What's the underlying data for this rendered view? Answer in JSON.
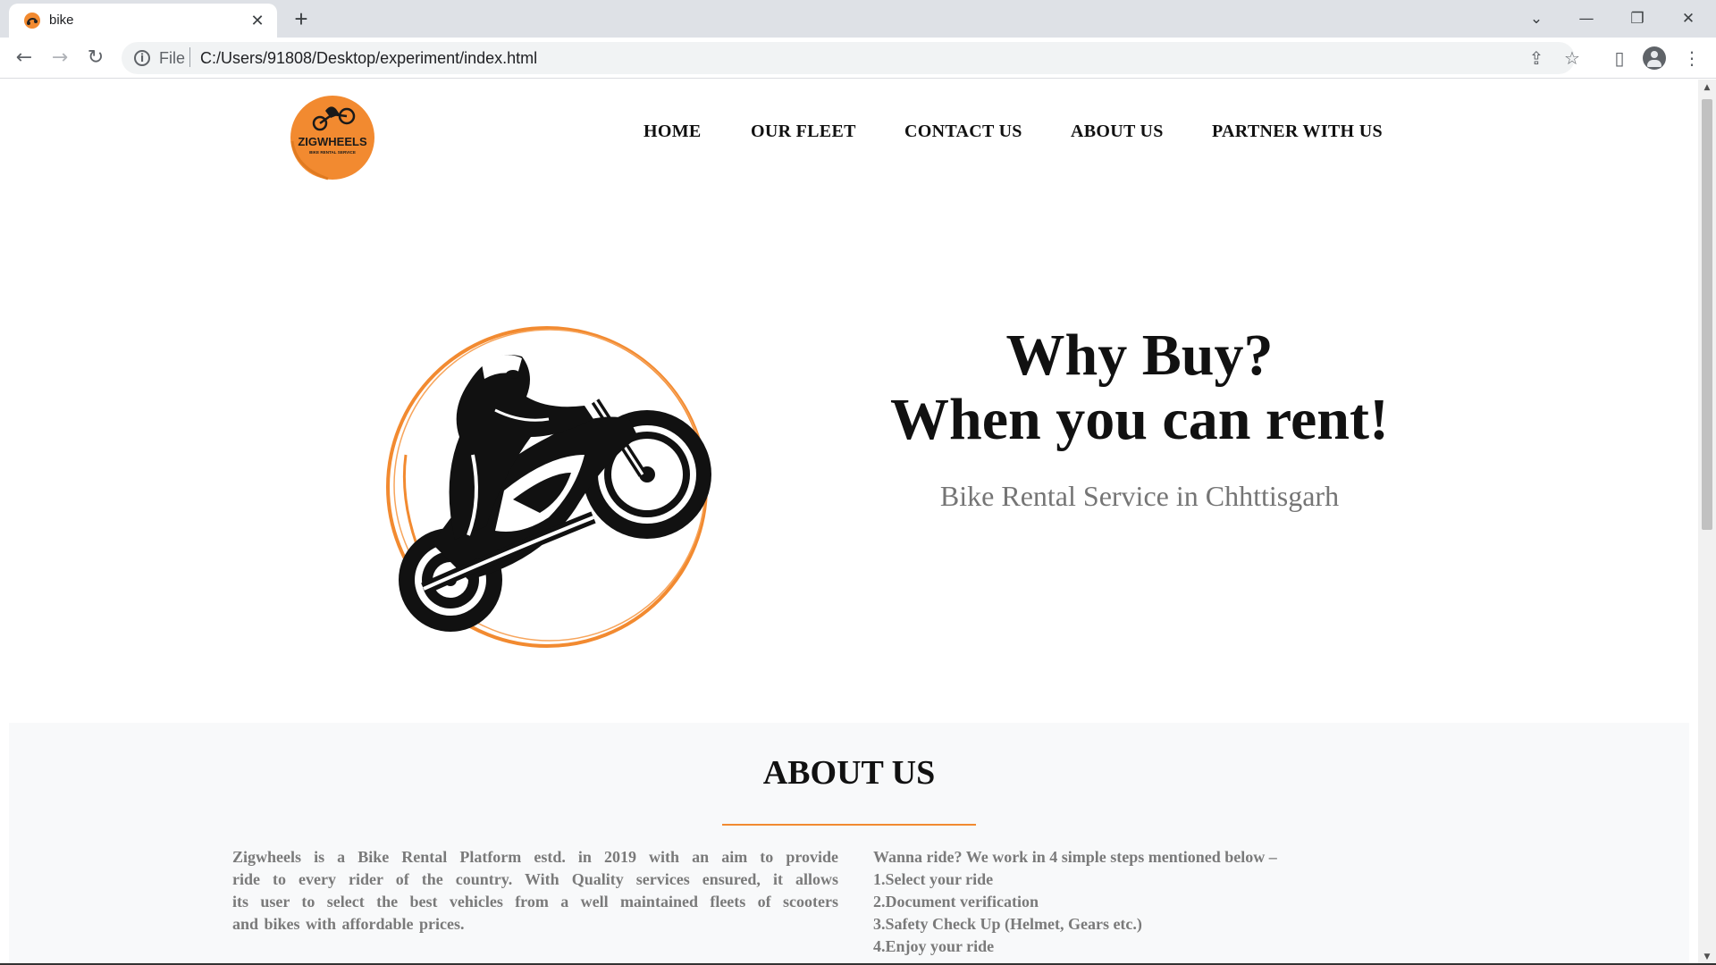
{
  "browser": {
    "tab_title": "bike",
    "tab_close": "✕",
    "new_tab": "+",
    "scheme_label": "File",
    "url": "C:/Users/91808/Desktop/experiment/index.html",
    "icons": {
      "back": "←",
      "forward": "→",
      "reload": "↻",
      "share": "⇪",
      "bookmark": "☆",
      "side_panel": "▯",
      "menu": "⋮",
      "tab_search": "⌄",
      "minimize": "—",
      "restore": "❐",
      "close": "✕",
      "info": "i"
    }
  },
  "site": {
    "logo_text": "ZIGWHEELS",
    "logo_subtext": "BIKE RENTAL SERVICE",
    "nav": [
      "HOME",
      "OUR FLEET",
      "CONTACT US",
      "ABOUT US",
      "PARTNER WITH US"
    ],
    "hero": {
      "line1": "Why Buy?",
      "line2": "When you can rent!",
      "subtitle": "Bike Rental Service in Chhttisgarh"
    },
    "about": {
      "title": "ABOUT US",
      "paragraph_lines": [
        "Zigwheels is a Bike Rental Platform estd. in 2019 with an aim to provide",
        "ride to every rider of the country. With Quality services ensured, it allows",
        "its user to select the best vehicles from a well maintained fleets of scooters",
        "and bikes with affordable prices."
      ],
      "steps_intro": "Wanna ride? We work in 4 simple steps mentioned below –",
      "steps": [
        "1.Select your ride",
        "2.Document verification",
        "3.Safety Check Up (Helmet, Gears etc.)",
        "4.Enjoy your ride"
      ]
    }
  },
  "colors": {
    "accent_orange": "#f28a30",
    "text_dark": "#111111",
    "text_grey": "#7a7a7a",
    "section_bg": "#f8f9fa"
  }
}
